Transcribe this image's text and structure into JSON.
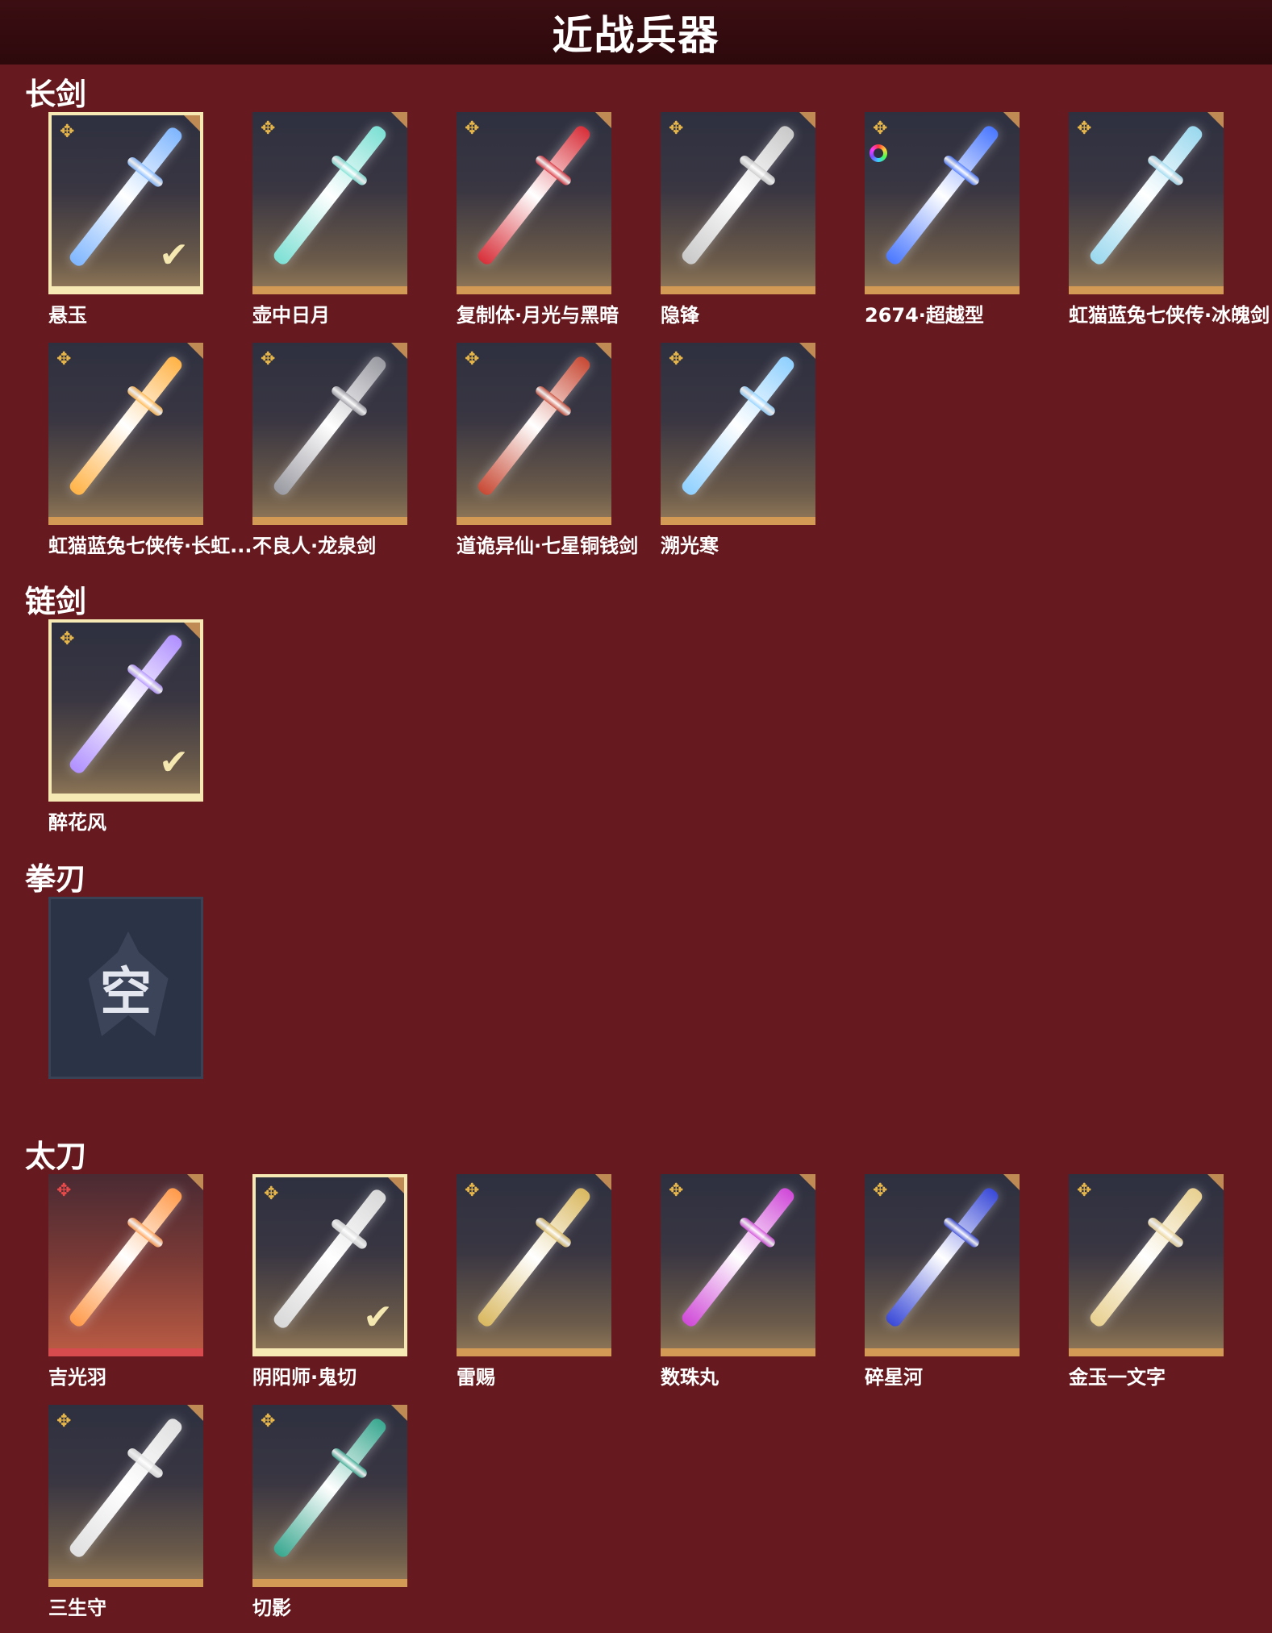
{
  "page_title": "近战兵器",
  "colors": {
    "background": "#661a1f",
    "title_bar": "#2d090c",
    "tile_border_gold": "#d39a56",
    "tile_border_red": "#d74b4f",
    "selected_border": "#f6e9b4"
  },
  "icons": {
    "rarity": "✥",
    "check": "✔"
  },
  "sections": [
    {
      "title": "长剑",
      "items": [
        {
          "name": "悬玉",
          "selected": true,
          "color": "#7fb6ff"
        },
        {
          "name": "壶中日月",
          "selected": false,
          "color": "#7de0d4"
        },
        {
          "name": "复制体·月光与黑暗",
          "selected": false,
          "color": "#d8303a"
        },
        {
          "name": "隐锋",
          "selected": false,
          "color": "#c9c9c9"
        },
        {
          "name": "2674·超越型",
          "selected": false,
          "color": "#4a78ff",
          "color_ring": true
        },
        {
          "name": "虹猫蓝兔七侠传·冰魄剑",
          "selected": false,
          "color": "#9ad8ee"
        },
        {
          "name": "虹猫蓝兔七侠传·长虹...",
          "selected": false,
          "color": "#ffb347"
        },
        {
          "name": "不良人·龙泉剑",
          "selected": false,
          "color": "#9a9aa2"
        },
        {
          "name": "道诡异仙·七星铜钱剑",
          "selected": false,
          "color": "#c84a35"
        },
        {
          "name": "溯光寒",
          "selected": false,
          "color": "#8fd0ff"
        }
      ]
    },
    {
      "title": "链剑",
      "items": [
        {
          "name": "醉花风",
          "selected": true,
          "color": "#b090ff"
        }
      ]
    },
    {
      "title": "拳刃",
      "items": [
        {
          "name": "",
          "empty": true,
          "empty_label": "空"
        }
      ]
    },
    {
      "title": "太刀",
      "items": [
        {
          "name": "吉光羽",
          "selected": false,
          "legend": true,
          "color": "#ff9a4a"
        },
        {
          "name": "阴阳师·鬼切",
          "selected": true,
          "color": "#d8d8d8"
        },
        {
          "name": "雷赐",
          "selected": false,
          "color": "#d9b860"
        },
        {
          "name": "数珠丸",
          "selected": false,
          "color": "#d04ad8"
        },
        {
          "name": "碎星河",
          "selected": false,
          "color": "#3a4ad8"
        },
        {
          "name": "金玉一文字",
          "selected": false,
          "color": "#e8d090"
        },
        {
          "name": "三生守",
          "selected": false,
          "color": "#e0e0e0"
        },
        {
          "name": "切影",
          "selected": false,
          "color": "#3aa890"
        }
      ]
    }
  ]
}
